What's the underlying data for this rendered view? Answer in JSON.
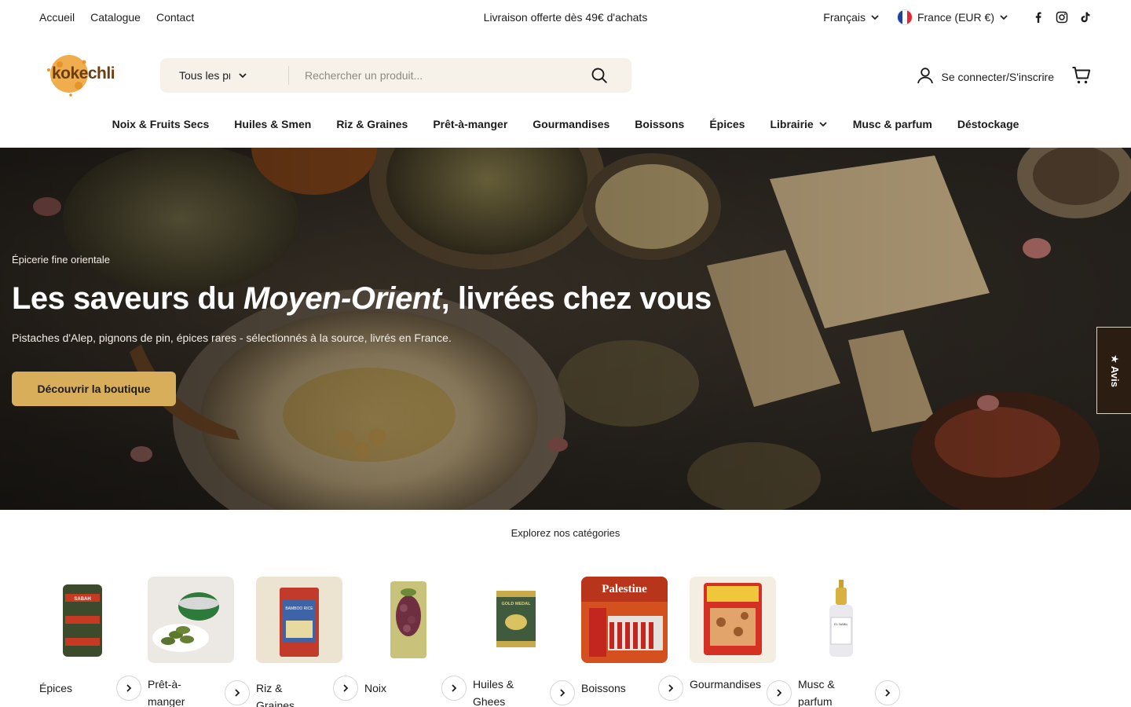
{
  "topbar": {
    "links": [
      "Accueil",
      "Catalogue",
      "Contact"
    ],
    "promo": "Livraison offerte dès 49€ d'achats",
    "language": "Français",
    "country": "France (EUR €)",
    "social": [
      "facebook-icon",
      "instagram-icon",
      "tiktok-icon"
    ]
  },
  "header": {
    "logo_text": "kokechli",
    "search": {
      "category": "Tous les produits",
      "placeholder": "Rechercher un produit..."
    },
    "account_label": "Se connecter/S'inscrire"
  },
  "nav": {
    "items": [
      "Noix & Fruits Secs",
      "Huiles & Smen",
      "Riz & Graines",
      "Prêt-à-manger",
      "Gourmandises",
      "Boissons",
      "Épices",
      "Librairie",
      "Musc & parfum",
      "Déstockage"
    ]
  },
  "hero": {
    "eyebrow": "Épicerie fine orientale",
    "title_prefix": "Les saveurs du ",
    "title_emphasis": "Moyen-Orient",
    "title_suffix": ", livrées chez vous",
    "subtitle": "Pistaches d'Alep, pignons de pin, épices rares - sélectionnés à la source, livrés en France.",
    "cta": "Découvrir la boutique"
  },
  "reviews_tab": "★ Avis",
  "categories": {
    "heading": "Explorez nos catégories",
    "items": [
      {
        "label": "Épices",
        "image_text": "SABAH"
      },
      {
        "label": "Prêt-à-manger",
        "image_text": ""
      },
      {
        "label": "Riz & Graines",
        "image_text": "BAMBOO RICE"
      },
      {
        "label": "Noix",
        "image_text": ""
      },
      {
        "label": "Huiles & Ghees",
        "image_text": "GOLD MEDAL"
      },
      {
        "label": "Boissons",
        "image_text": "Palestine"
      },
      {
        "label": "Gourmandises",
        "image_text": ""
      },
      {
        "label": "Musc & parfum",
        "image_text": "EL NABIL"
      }
    ]
  },
  "colors": {
    "accent": "#d8ae5b",
    "search_bg": "#f6f2ea",
    "hero_dark": "#2b2620",
    "reviews_bg": "#2b1d12"
  }
}
